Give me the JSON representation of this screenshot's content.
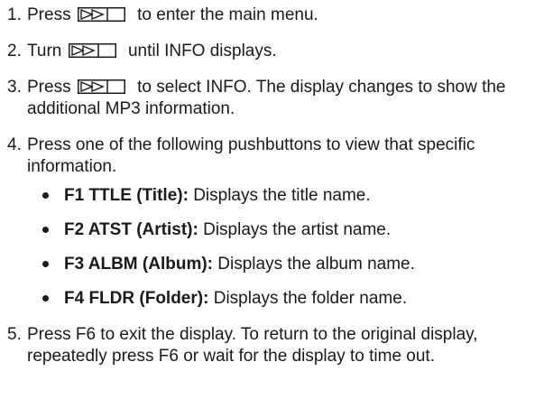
{
  "steps": [
    {
      "num": "1.",
      "pre": "Press",
      "post": "to enter the main menu.",
      "icon": "play-pause-button-icon"
    },
    {
      "num": "2.",
      "pre": "Turn",
      "post": "until INFO displays.",
      "icon": "play-pause-button-icon"
    },
    {
      "num": "3.",
      "pre": "Press",
      "post": "to select INFO. The display changes to show the additional MP3 information.",
      "icon": "play-pause-button-icon"
    },
    {
      "num": "4.",
      "text": "Press one of the following pushbuttons to view that specific information.",
      "bullets": [
        {
          "label": "F1 TTLE (Title):",
          "desc": "Displays the title name."
        },
        {
          "label": "F2 ATST (Artist):",
          "desc": "Displays the artist name."
        },
        {
          "label": "F3 ALBM (Album):",
          "desc": "Displays the album name."
        },
        {
          "label": "F4 FLDR (Folder):",
          "desc": "Displays the folder name."
        }
      ]
    },
    {
      "num": "5.",
      "text": "Press F6 to exit the display. To return to the original display, repeatedly press F6 or wait for the display to time out."
    }
  ]
}
